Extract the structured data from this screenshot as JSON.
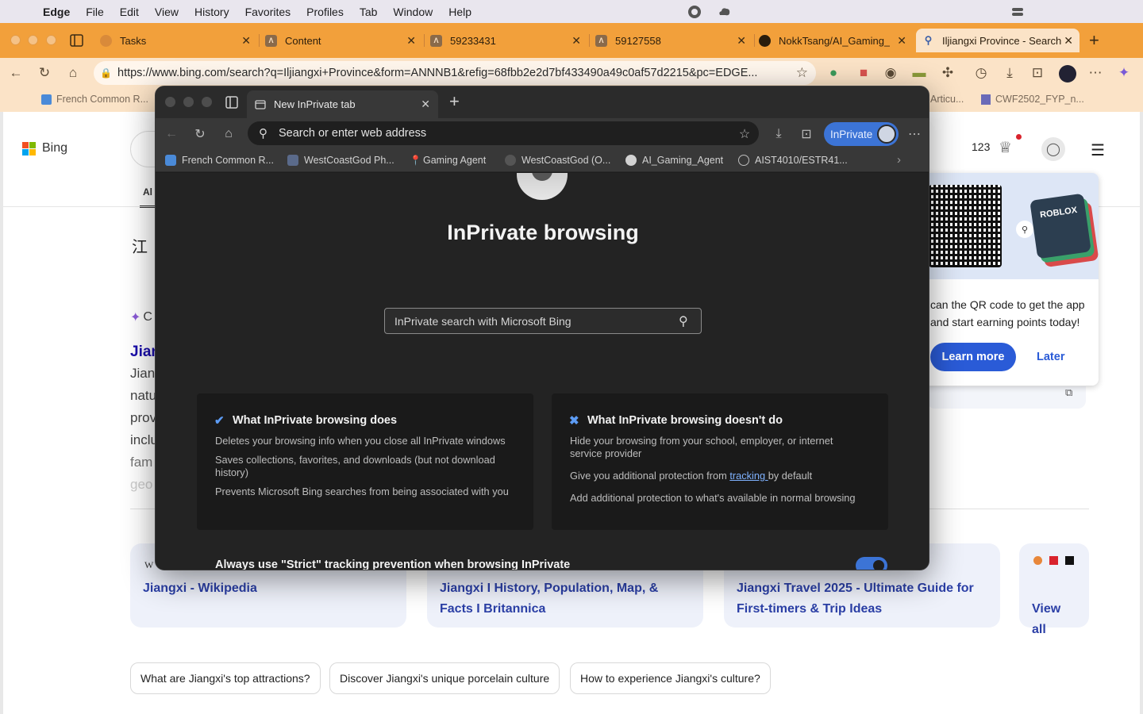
{
  "menubar": {
    "app": "Edge",
    "items": [
      "File",
      "Edit",
      "View",
      "History",
      "Favorites",
      "Profiles",
      "Tab",
      "Window",
      "Help"
    ]
  },
  "outer_tabs": [
    {
      "label": "Tasks"
    },
    {
      "label": "Content"
    },
    {
      "label": "59233431"
    },
    {
      "label": "59127558"
    },
    {
      "label": "NokkTsang/AI_Gaming_Ag"
    },
    {
      "label": "Iljiangxi Province - Search"
    }
  ],
  "outer_toolbar": {
    "url": "https://www.bing.com/search?q=Iljiangxi+Province&form=ANNNB1&refig=68fbb2e2d7bf433490a49c0af57d2215&pc=EDGE..."
  },
  "outer_bookmarks": {
    "first": "French Common R...",
    "right1": "Articu...",
    "right2": "CWF2502_FYP_n..."
  },
  "bing": {
    "logo_text": "Bing",
    "points": "123",
    "all_tab": "Al",
    "chinese_title": "江",
    "copilot_stub": "C",
    "result_title_stub": "Jian",
    "result_lines": [
      "Jian",
      "natu",
      "prov",
      "inclu",
      "fam",
      "geo"
    ],
    "promo": {
      "text": "can the QR code to get the app and start earning points today!",
      "learn_more": "Learn more",
      "later": "Later",
      "roblox": "ROBLOX"
    },
    "cards": [
      {
        "title": "Jiangxi - Wikipedia",
        "source_icon": "W"
      },
      {
        "title": "Jiangxi I History, Population, Map, & Facts I Britannica"
      },
      {
        "title": "Jiangxi Travel 2025 - Ultimate Guide for First-timers & Trip Ideas"
      },
      {
        "title": "View all"
      }
    ],
    "chips": [
      "What are Jiangxi's top attractions?",
      "Discover Jiangxi's unique porcelain culture",
      "How to experience Jiangxi's culture?"
    ]
  },
  "inprivate": {
    "tab_label": "New InPrivate tab",
    "address_placeholder": "Search or enter web address",
    "badge": "InPrivate",
    "bookmarks": [
      "French Common R...",
      "WestCoastGod Ph...",
      "Gaming Agent",
      "WestCoastGod (O...",
      "AI_Gaming_Agent",
      "AIST4010/ESTR41..."
    ],
    "title": "InPrivate browsing",
    "search_placeholder": "InPrivate search with Microsoft Bing",
    "does": {
      "heading": "What InPrivate browsing does",
      "items": [
        "Deletes your browsing info when you close all InPrivate windows",
        "Saves collections, favorites, and downloads (but not download history)",
        "Prevents Microsoft Bing searches from being associated with you"
      ]
    },
    "doesnt": {
      "heading": "What InPrivate browsing doesn't do",
      "item1": "Hide your browsing from your school, employer, or internet service provider",
      "item2_pre": "Give you additional protection from ",
      "item2_link": "tracking ",
      "item2_post": "by default",
      "item3": "Add additional protection to what's available in normal browsing"
    },
    "strict_label": "Always use \"Strict\" tracking prevention when browsing InPrivate"
  },
  "colors": {
    "tabstrip": "#f2a03b",
    "toolbar": "#fbe3c7",
    "inprivate_accent": "#3c74d6",
    "bing_link": "#2b3fa6"
  }
}
